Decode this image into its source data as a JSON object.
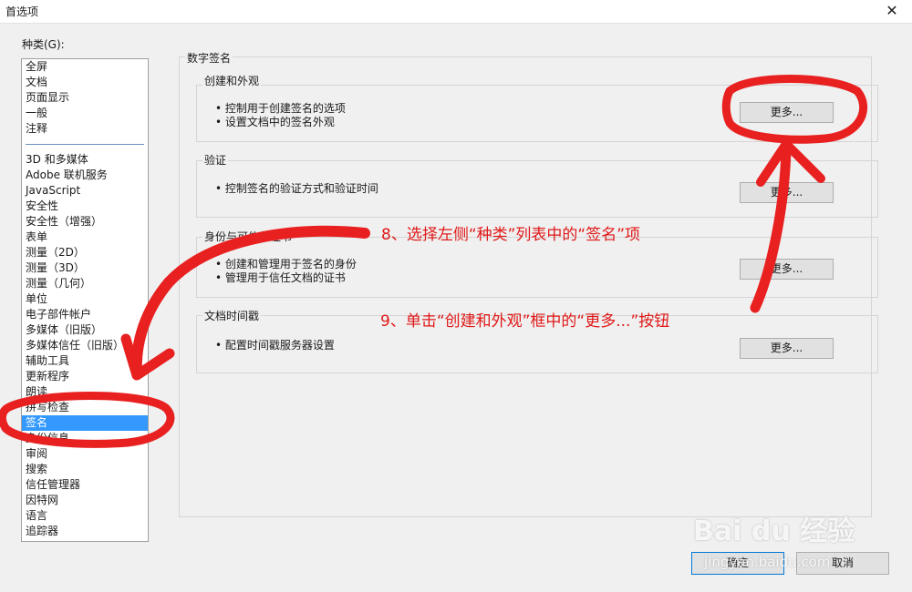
{
  "window": {
    "title": "首选项",
    "close_glyph": "✕"
  },
  "category_label": "种类(G):",
  "categories_top": [
    "全屏",
    "文档",
    "页面显示",
    "一般",
    "注释"
  ],
  "categories_bottom": [
    "3D 和多媒体",
    "Adobe 联机服务",
    "JavaScript",
    "安全性",
    "安全性（增强）",
    "表单",
    "测量（2D）",
    "测量（3D）",
    "测量（几何）",
    "单位",
    "电子部件帐户",
    "多媒体（旧版）",
    "多媒体信任（旧版）",
    "辅助工具",
    "更新程序",
    "朗读",
    "拼写检查",
    "签名",
    "身份信息",
    "审阅",
    "搜索",
    "信任管理器",
    "因特网",
    "语言",
    "追踪器"
  ],
  "selected_category": "签名",
  "group_title": "数字签名",
  "sections": {
    "create": {
      "title": "创建和外观",
      "bullets": [
        "控制用于创建签名的选项",
        "设置文档中的签名外观"
      ],
      "button": "更多..."
    },
    "verify": {
      "title": "验证",
      "bullets": [
        "控制签名的验证方式和验证时间"
      ],
      "button": "更多..."
    },
    "identity": {
      "title": "身份与可信任证书",
      "bullets": [
        "创建和管理用于签名的身份",
        "管理用于信任文档的证书"
      ],
      "button": "更多..."
    },
    "timestamp": {
      "title": "文档时间戳",
      "bullets": [
        "配置时间戳服务器设置"
      ],
      "button": "更多..."
    }
  },
  "footer": {
    "ok": "确定",
    "cancel": "取消"
  },
  "annotations": {
    "step8": "8、选择左侧“种类”列表中的“签名”项",
    "step9": "9、单击“创建和外观”框中的“更多...”按钮"
  },
  "watermark": {
    "brand": "Bai du 经验",
    "url": "jingyan.baidu.com"
  },
  "colors": {
    "annotation": "#e01818",
    "selection": "#3399ff"
  }
}
